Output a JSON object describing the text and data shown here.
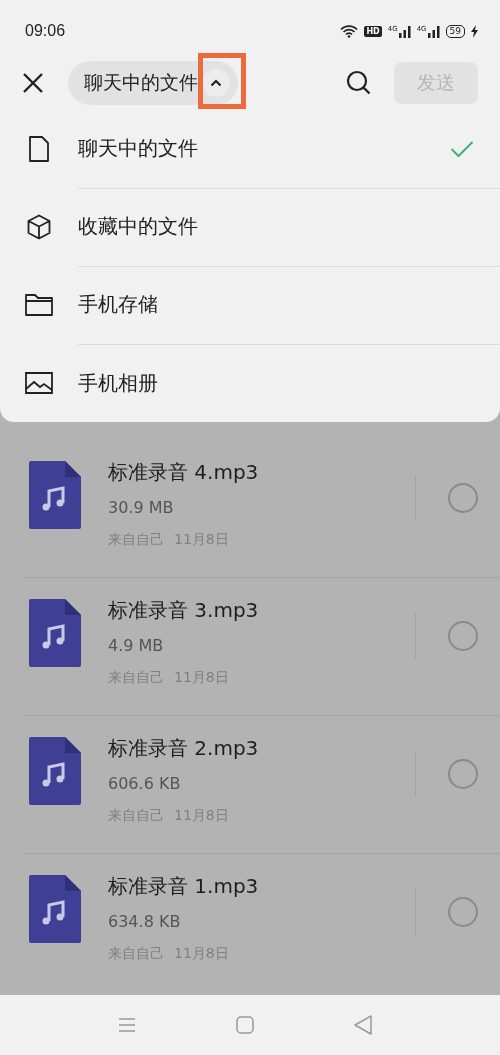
{
  "status_bar": {
    "time": "09:06",
    "hd": "HD",
    "network_1": "4G",
    "network_2": "4G",
    "battery": "59"
  },
  "header": {
    "source_label": "聊天中的文件",
    "send_button": {
      "label": "发送",
      "disabled": true
    }
  },
  "source_menu": [
    {
      "kind": "chat",
      "label": "聊天中的文件",
      "selected": true
    },
    {
      "kind": "favorites",
      "label": "收藏中的文件",
      "selected": false
    },
    {
      "kind": "storage",
      "label": "手机存储",
      "selected": false
    },
    {
      "kind": "album",
      "label": "手机相册",
      "selected": false
    }
  ],
  "files": [
    {
      "name": "标准录音 4.mp3",
      "size": "30.9 MB",
      "source": "来自自己",
      "date": "11月8日",
      "selected": false
    },
    {
      "name": "标准录音 3.mp3",
      "size": "4.9 MB",
      "source": "来自自己",
      "date": "11月8日",
      "selected": false
    },
    {
      "name": "标准录音 2.mp3",
      "size": "606.6 KB",
      "source": "来自自己",
      "date": "11月8日",
      "selected": false
    },
    {
      "name": "标准录音 1.mp3",
      "size": "634.8 KB",
      "source": "来自自己",
      "date": "11月8日",
      "selected": false
    }
  ]
}
